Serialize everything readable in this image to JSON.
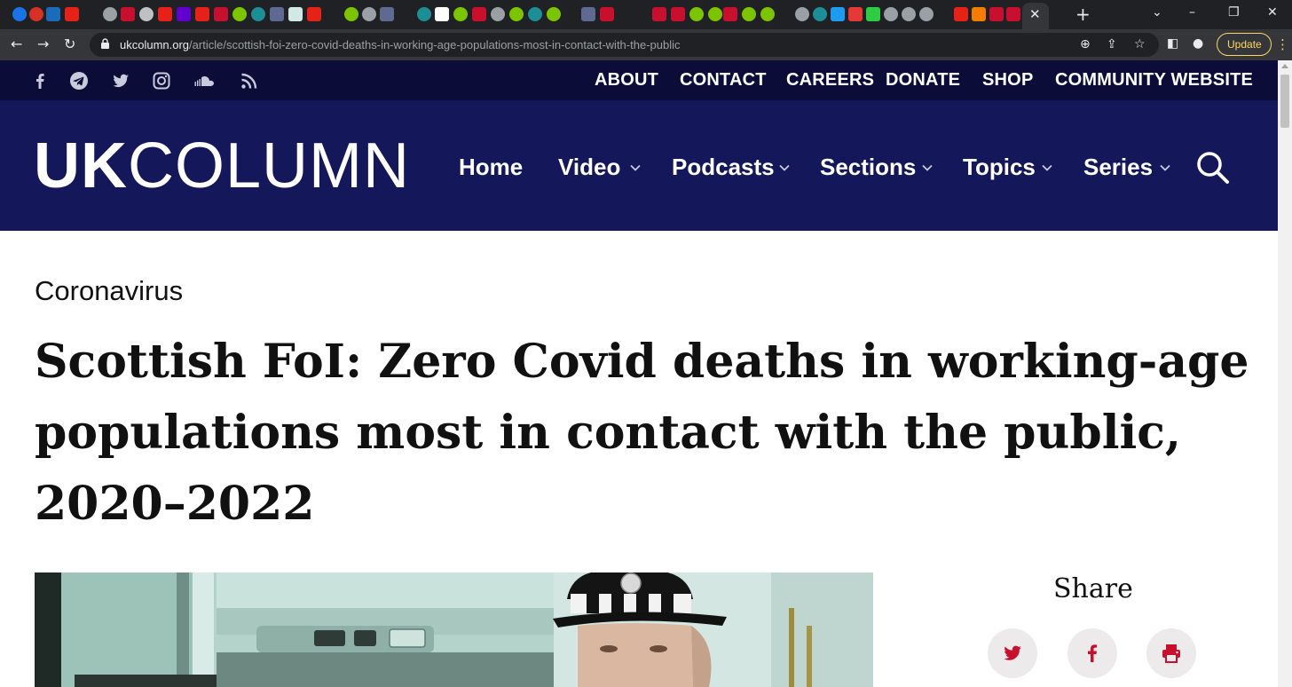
{
  "browser": {
    "url_host": "ukcolumn.org",
    "url_path": "/article/scottish-foi-zero-covid-deaths-in-working-age-populations-most-in-contact-with-the-public",
    "update_label": "Update",
    "close_tab_glyph": "✕",
    "new_tab_glyph": "+",
    "accent_color": "#fdd663"
  },
  "topbar": {
    "social_icons": [
      "facebook-icon",
      "telegram-icon",
      "twitter-icon",
      "instagram-icon",
      "soundcloud-icon",
      "rss-icon"
    ],
    "links": [
      "ABOUT",
      "CONTACT",
      "CAREERS",
      "DONATE",
      "SHOP",
      "COMMUNITY WEBSITE"
    ]
  },
  "nav": {
    "logo_bold": "UK",
    "logo_light": "COLUMN",
    "home": "Home",
    "video": "Video",
    "podcasts": "Podcasts",
    "sections": "Sections",
    "topics": "Topics",
    "series": "Series"
  },
  "article": {
    "category": "Coronavirus",
    "headline_line1": "Scottish FoI: Zero Covid deaths in working-age",
    "headline_line2": "populations most in contact with the public,",
    "headline_line3": "2020–2022"
  },
  "share": {
    "title": "Share",
    "buttons": [
      "twitter-icon",
      "facebook-icon",
      "print-icon"
    ],
    "icon_color": "#c8102e"
  },
  "colors": {
    "topbar_bg": "#0b0d38",
    "nav_bg": "#14185a"
  }
}
